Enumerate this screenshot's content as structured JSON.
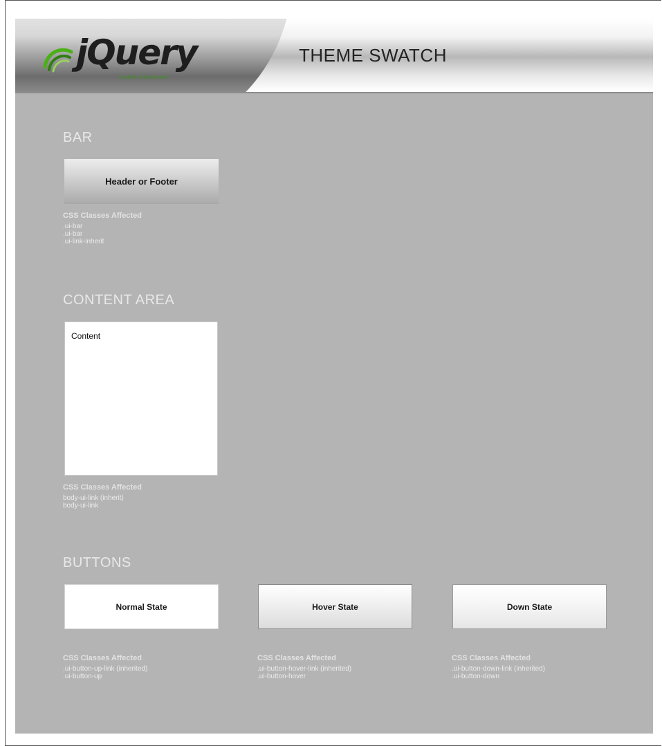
{
  "header": {
    "logo_text": "jQuery",
    "logo_tagline": "mobile framework",
    "title": "THEME SWATCH"
  },
  "bar": {
    "section_title": "BAR",
    "swatch_label": "Header or Footer",
    "css_title": "CSS Classes Affected",
    "css_classes": [
      ".ui-bar",
      ".ui-bar",
      ".ui-link-inherit"
    ]
  },
  "content": {
    "section_title": "CONTENT AREA",
    "swatch_label": "Content",
    "css_title": "CSS Classes Affected",
    "css_classes": [
      "body-ui-link (inherit)",
      "body-ui-link"
    ]
  },
  "buttons": {
    "section_title": "BUTTONS",
    "items": [
      {
        "label": "Normal State",
        "css_title": "CSS Classes Affected",
        "css_classes": [
          ".ui-button-up-link (inherited)",
          ".ui-button-up"
        ]
      },
      {
        "label": "Hover State",
        "css_title": "CSS Classes Affected",
        "css_classes": [
          ".ui-button-hover-link (inherited)",
          ".ui-button-hover"
        ]
      },
      {
        "label": "Down State",
        "css_title": "CSS Classes Affected",
        "css_classes": [
          ".ui-button-down-link (inherited)",
          ".ui-button-down"
        ]
      }
    ]
  },
  "colors": {
    "canvas_bg": "#b4b4b4",
    "label_light": "#e8e8e8",
    "logo_green": "#3f8f1f"
  }
}
